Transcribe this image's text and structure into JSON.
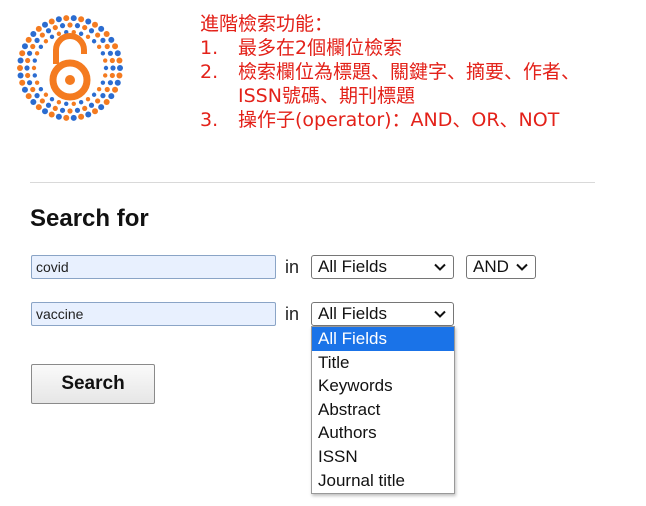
{
  "colors": {
    "notes_red": "#e32119",
    "logo_orange": "#f47b20",
    "logo_blue": "#2b6cd0",
    "option_selected_bg": "#1a73e8"
  },
  "logo": {
    "name": "open-access-lock-logo"
  },
  "notes": {
    "heading": "進階檢索功能：",
    "items": [
      {
        "num": "1.",
        "lines": [
          "最多在2個欄位檢索"
        ]
      },
      {
        "num": "2.",
        "lines": [
          "檢索欄位為標題、關鍵字、摘要、作者、",
          "ISSN號碼、期刊標題"
        ]
      },
      {
        "num": "3.",
        "lines": [
          "操作子(operator)：AND、OR、NOT"
        ]
      }
    ]
  },
  "search": {
    "title": "Search for",
    "in_label": "in",
    "row1": {
      "value": "covid",
      "field": "All Fields",
      "operator": "AND"
    },
    "row2": {
      "value": "vaccine",
      "field": "All Fields"
    },
    "field_options": [
      "All Fields",
      "Title",
      "Keywords",
      "Abstract",
      "Authors",
      "ISSN",
      "Journal title"
    ],
    "field_options_selected_index": 0,
    "button": "Search"
  }
}
